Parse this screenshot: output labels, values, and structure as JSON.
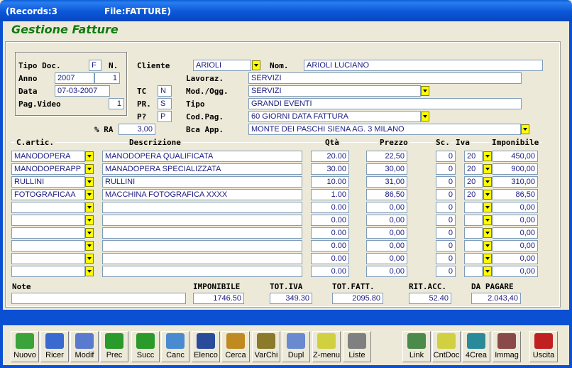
{
  "window": {
    "records": "(Records:3",
    "file": "File:FATTURE)"
  },
  "heading": "Gestione Fatture",
  "labels": {
    "tipo_doc": "Tipo Doc.",
    "n": "N.",
    "anno": "Anno",
    "data": "Data",
    "pag_video": "Pag.Video",
    "cliente": "Cliente",
    "nom": "Nom.",
    "lavoraz": "Lavoraz.",
    "tc": "TC",
    "mod_ogg": "Mod./Ogg.",
    "pr": "PR.",
    "tipo": "Tipo",
    "pq": "P?",
    "cod_pag": "Cod.Pag.",
    "ra": "% RA",
    "bca_app": "Bca App.",
    "c_artic": "C.artic.",
    "descrizione": "Descrizione",
    "qta": "Qtà",
    "prezzo": "Prezzo",
    "sc": "Sc.",
    "iva": "Iva",
    "imponibile": "Imponibile",
    "note": "Note",
    "tot_imponibile": "IMPONIBILE",
    "tot_iva": "TOT.IVA",
    "tot_fatt": "TOT.FATT.",
    "rit_acc": "RIT.ACC.",
    "da_pagare": "DA PAGARE"
  },
  "header": {
    "tipo_doc": "F",
    "n": "",
    "anno": "2007",
    "n2": "1",
    "data": "07-03-2007",
    "pag_video": "1",
    "cliente": "ARIOLI",
    "nom": "ARIOLI LUCIANO",
    "lavoraz": "SERVIZI",
    "tc": "N",
    "mod_ogg": "SERVIZI",
    "pr": "S",
    "tipo": "GRANDI EVENTI",
    "pq": "P",
    "cod_pag": "60 GIORNI DATA FATTURA",
    "ra": "3,00",
    "bca_app": "MONTE DEI PASCHI SIENA  AG. 3  MILANO"
  },
  "rows": [
    {
      "code": "MANODOPERA",
      "desc": "MANODOPERA QUALIFICATA",
      "qta": "20.00",
      "prezzo": "22,50",
      "sc": "0",
      "iva": "20",
      "imp": "450,00"
    },
    {
      "code": "MANODOPERAPP",
      "desc": "MANADOPERA SPECIALIZZATA",
      "qta": "30.00",
      "prezzo": "30,00",
      "sc": "0",
      "iva": "20",
      "imp": "900,00"
    },
    {
      "code": "RULLINI",
      "desc": "RULLINI",
      "qta": "10.00",
      "prezzo": "31,00",
      "sc": "0",
      "iva": "20",
      "imp": "310,00"
    },
    {
      "code": "FOTOGRAFICAA",
      "desc": "MACCHINA FOTOGRAFICA XXXX",
      "qta": "1.00",
      "prezzo": "86,50",
      "sc": "0",
      "iva": "20",
      "imp": "86,50"
    },
    {
      "code": "",
      "desc": "",
      "qta": "0.00",
      "prezzo": "0,00",
      "sc": "0",
      "iva": "",
      "imp": "0,00"
    },
    {
      "code": "",
      "desc": "",
      "qta": "0.00",
      "prezzo": "0,00",
      "sc": "0",
      "iva": "",
      "imp": "0,00"
    },
    {
      "code": "",
      "desc": "",
      "qta": "0.00",
      "prezzo": "0,00",
      "sc": "0",
      "iva": "",
      "imp": "0,00"
    },
    {
      "code": "",
      "desc": "",
      "qta": "0.00",
      "prezzo": "0,00",
      "sc": "0",
      "iva": "",
      "imp": "0,00"
    },
    {
      "code": "",
      "desc": "",
      "qta": "0.00",
      "prezzo": "0,00",
      "sc": "0",
      "iva": "",
      "imp": "0,00"
    },
    {
      "code": "",
      "desc": "",
      "qta": "0.00",
      "prezzo": "0,00",
      "sc": "0",
      "iva": "",
      "imp": "0,00"
    }
  ],
  "totals": {
    "note": "",
    "imponibile": "1746.50",
    "tot_iva": "349.30",
    "tot_fatt": "2095.80",
    "rit_acc": "52.40",
    "da_pagare": "2.043,40"
  },
  "toolbar": [
    {
      "label": "Nuovo",
      "icon": "new-document-icon",
      "color": "#3aa33a"
    },
    {
      "label": "Ricer",
      "icon": "search-icon",
      "color": "#3a6ad0"
    },
    {
      "label": "Modif",
      "icon": "edit-icon",
      "color": "#5a7ad0"
    },
    {
      "label": "Prec",
      "icon": "arrow-left-icon",
      "color": "#2a9a2a"
    },
    {
      "label": "Succ",
      "icon": "arrow-right-icon",
      "color": "#2a9a2a"
    },
    {
      "label": "Canc",
      "icon": "trash-icon",
      "color": "#4a8ad0"
    },
    {
      "label": "Elenco",
      "icon": "list-icon",
      "color": "#2a4a9a"
    },
    {
      "label": "Cerca",
      "icon": "find-icon",
      "color": "#c08a20"
    },
    {
      "label": "VarChi",
      "icon": "keys-icon",
      "color": "#8a7a2a"
    },
    {
      "label": "Dupl",
      "icon": "duplicate-icon",
      "color": "#6a8ad0"
    },
    {
      "label": "Z-menu",
      "icon": "z-menu-icon",
      "color": "#d0d040"
    },
    {
      "label": "Liste",
      "icon": "printer-icon",
      "color": "#808080"
    },
    {
      "label": "Link",
      "icon": "link-icon",
      "color": "#4a8a4a"
    },
    {
      "label": "CntDoc",
      "icon": "count-doc-icon",
      "color": "#d0d040"
    },
    {
      "label": "4Crea",
      "icon": "create-icon",
      "color": "#2a8a9a"
    },
    {
      "label": "Immag",
      "icon": "image-icon",
      "color": "#8a4a4a"
    },
    {
      "label": "Uscita",
      "icon": "exit-icon",
      "color": "#c02020"
    }
  ]
}
